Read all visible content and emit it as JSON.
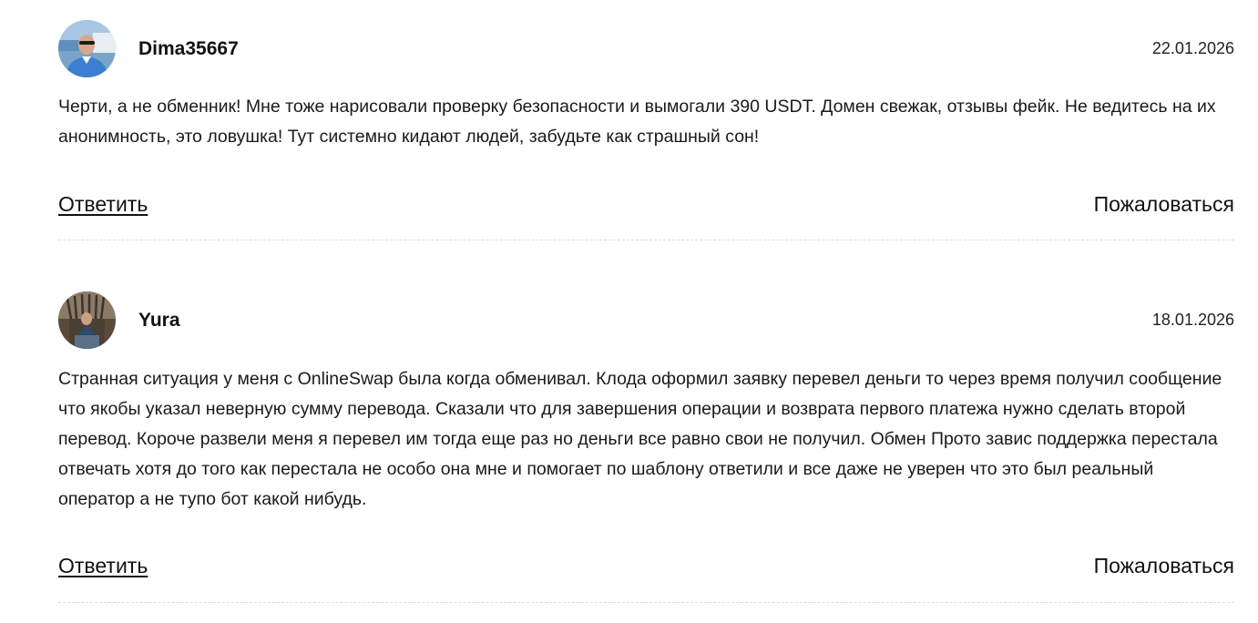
{
  "comments": [
    {
      "author": "Dima35667",
      "date": "22.01.2026",
      "text": "Черти, а не обменник! Мне тоже нарисовали проверку безопасности и вымогали 390 USDT. Домен свежак, отзывы фейк. Не ведитесь на их анонимность, это ловушка! Тут системно кидают людей, забудьте как страшный сон!",
      "reply_label": "Ответить",
      "report_label": "Пожаловаться",
      "avatar_icon": "user-photo-avatar-icon"
    },
    {
      "author": "Yura",
      "date": "18.01.2026",
      "text": "Странная ситуация у меня с OnlineSwap была когда обменивал. Клода оформил заявку перевел деньги то через время получил сообщение что якобы указал неверную сумму перевода. Сказали что для завершения операции и возврата первого платежа нужно сделать второй перевод. Короче развели меня я перевел им тогда еще раз но деньги все равно свои не получил. Обмен Прото завис поддержка перестала отвечать хотя до того как перестала не особо она мне и помогает по шаблону ответили и все даже не уверен что это был реальный оператор а не тупо бот какой нибудь.",
      "reply_label": "Ответить",
      "report_label": "Пожаловаться",
      "avatar_icon": "user-photo-avatar-icon"
    }
  ],
  "colors": {
    "text": "#111111",
    "divider": "#dcdcdc",
    "background": "#ffffff"
  }
}
